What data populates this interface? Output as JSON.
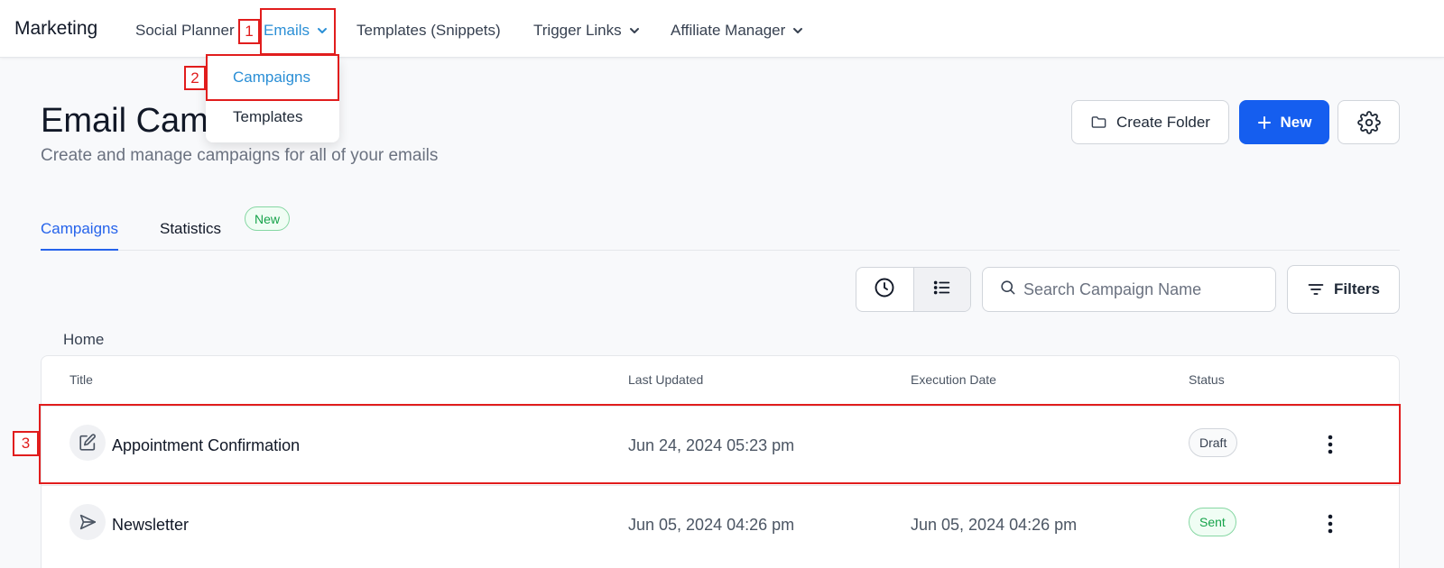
{
  "app": {
    "brand": "Marketing"
  },
  "nav": {
    "items": [
      {
        "label": "Social Planner"
      },
      {
        "label": "Emails"
      },
      {
        "label": "Templates (Snippets)"
      },
      {
        "label": "Trigger Links"
      },
      {
        "label": "Affiliate Manager"
      }
    ],
    "active": "Emails"
  },
  "dropdown": {
    "items": [
      {
        "label": "Campaigns"
      },
      {
        "label": "Templates"
      }
    ],
    "active": "Campaigns"
  },
  "annotations": [
    "1",
    "2",
    "3"
  ],
  "header": {
    "title": "Email Cam",
    "subtitle": "Create and manage campaigns for all of your emails",
    "create_folder_label": "Create Folder",
    "new_label": "New"
  },
  "tabs": {
    "items": [
      {
        "label": "Campaigns"
      },
      {
        "label": "Statistics"
      }
    ],
    "active": "Campaigns",
    "badge": "New"
  },
  "toolbar": {
    "search_placeholder": "Search Campaign Name",
    "filters_label": "Filters"
  },
  "breadcrumb": "Home",
  "table": {
    "columns": [
      "Title",
      "Last Updated",
      "Execution Date",
      "Status"
    ],
    "rows": [
      {
        "icon": "edit-icon",
        "title": "Appointment Confirmation",
        "last_updated": "Jun 24, 2024 05:23 pm",
        "execution_date": "",
        "status": "Draft"
      },
      {
        "icon": "send-icon",
        "title": "Newsletter",
        "last_updated": "Jun 05, 2024 04:26 pm",
        "execution_date": "Jun 05, 2024 04:26 pm",
        "status": "Sent"
      }
    ]
  },
  "colors": {
    "primary": "#155eef",
    "active_link": "#2b8fd6",
    "annotation": "#e11d1d",
    "status_sent": "#16a34a"
  }
}
